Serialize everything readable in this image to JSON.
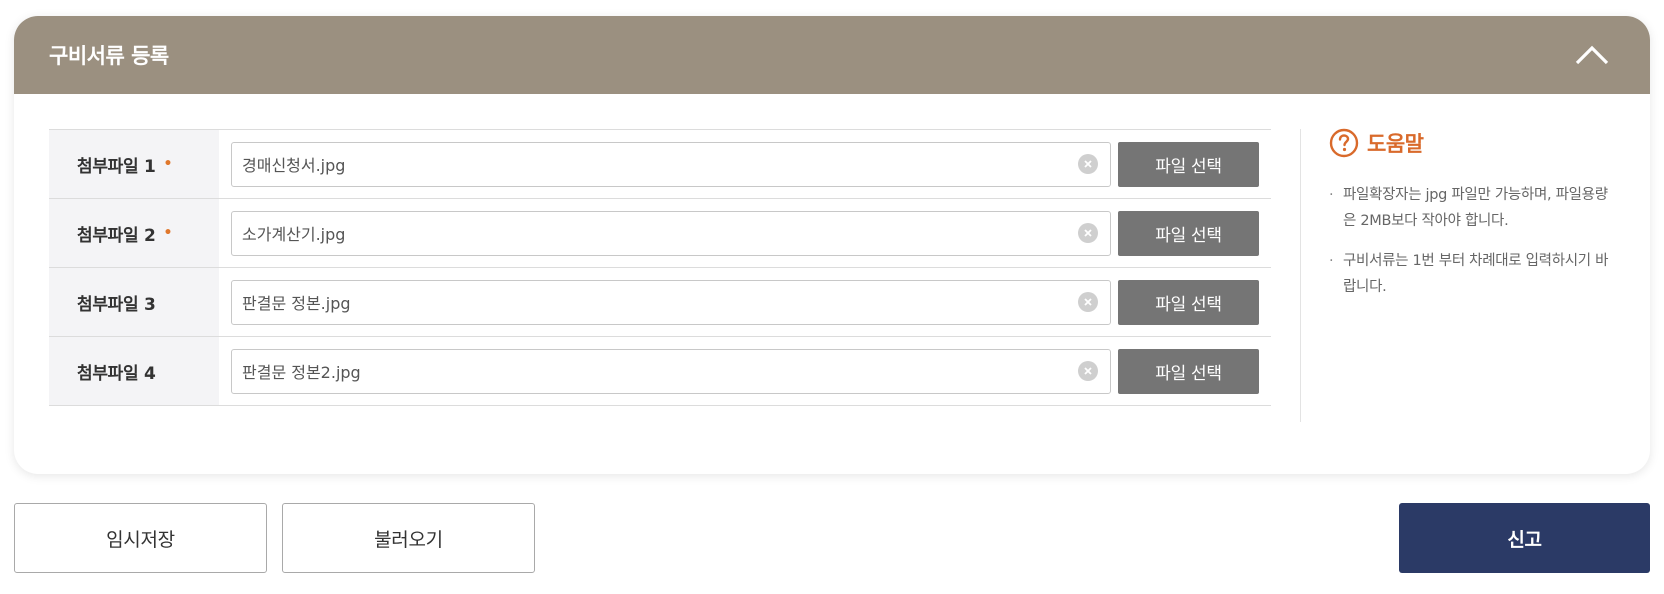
{
  "section": {
    "title": "구비서류 등록"
  },
  "files": [
    {
      "label": "첨부파일 1",
      "required": true,
      "filename": "경매신청서.jpg",
      "button": "파일 선택"
    },
    {
      "label": "첨부파일 2",
      "required": true,
      "filename": "소가계산기.jpg",
      "button": "파일 선택"
    },
    {
      "label": "첨부파일 3",
      "required": false,
      "filename": "판결문 정본.jpg",
      "button": "파일 선택"
    },
    {
      "label": "첨부파일 4",
      "required": false,
      "filename": "판결문 정본2.jpg",
      "button": "파일 선택"
    }
  ],
  "required_mark": "•",
  "help": {
    "title": "도움말",
    "icon": "question-circle-icon",
    "items": [
      "파일확장자는 jpg 파일만 가능하며, 파일용량은 2MB보다 작아야 합니다.",
      "구비서류는 1번 부터 차례대로 입력하시기 바랍니다."
    ]
  },
  "actions": {
    "temp_save": "임시저장",
    "load": "불러오기",
    "report": "신고"
  },
  "colors": {
    "header": "#9b9080",
    "accent": "#d96a2b",
    "primary": "#2b3a66",
    "select_button": "#757575"
  }
}
